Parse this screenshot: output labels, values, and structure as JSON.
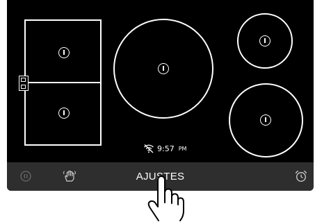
{
  "cooktop": {
    "zones": [
      {
        "name": "zona-trasera-izquierda"
      },
      {
        "name": "zona-delantera-izquierda"
      },
      {
        "name": "zona-central"
      },
      {
        "name": "zona-trasera-derecha"
      },
      {
        "name": "zona-delantera-derecha"
      }
    ],
    "bridge_icon": "bridge-zone-icon"
  },
  "status": {
    "wifi_icon": "wifi-off-icon",
    "time": "9:57",
    "ampm": "PM"
  },
  "bottom_bar": {
    "pause_icon": "pause-icon",
    "hand_icon": "hand-lock-icon",
    "label": "AJUSTES",
    "timer_icon": "alarm-clock-icon"
  },
  "colors": {
    "panel": "#000000",
    "bar": "#2e2e2e",
    "line": "#ffffff",
    "dim_icon": "#6a6a6a",
    "icon": "#cfcfcf"
  }
}
